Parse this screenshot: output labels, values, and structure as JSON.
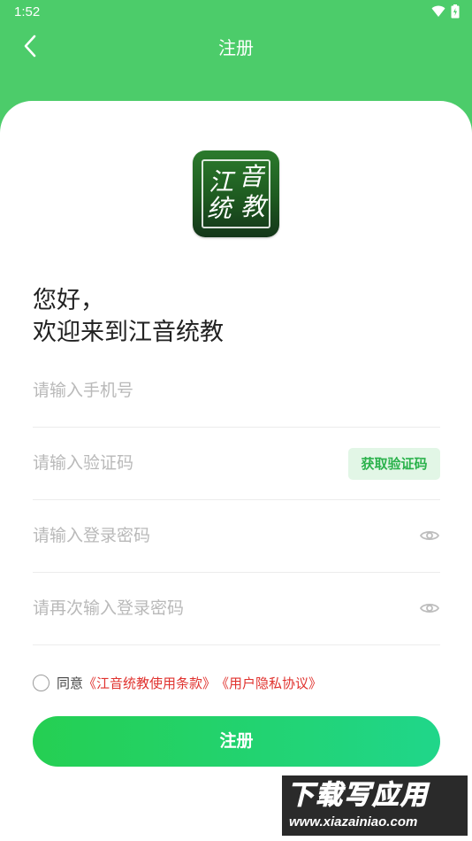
{
  "status_bar": {
    "time": "1:52"
  },
  "header": {
    "title": "注册"
  },
  "logo": {
    "chars": [
      "江",
      "音",
      "统",
      "教"
    ]
  },
  "greeting": {
    "line1": "您好，",
    "line2": "欢迎来到江音统教"
  },
  "form": {
    "phone_placeholder": "请输入手机号",
    "code_placeholder": "请输入验证码",
    "get_code_label": "获取验证码",
    "password_placeholder": "请输入登录密码",
    "confirm_placeholder": "请再次输入登录密码"
  },
  "agreement": {
    "prefix": "同意",
    "terms_link": "《江音统教使用条款》",
    "privacy_link": "《用户隐私协议》",
    "checked": false
  },
  "submit_label": "注册",
  "watermark": {
    "title": "下载写应用",
    "url": "www.xiazainiao.com"
  },
  "colors": {
    "header_bg": "#4ccc6a",
    "accent": "#2bb24c",
    "link": "#e0322e",
    "button_gradient": [
      "#25cf52",
      "#20d68a"
    ]
  }
}
